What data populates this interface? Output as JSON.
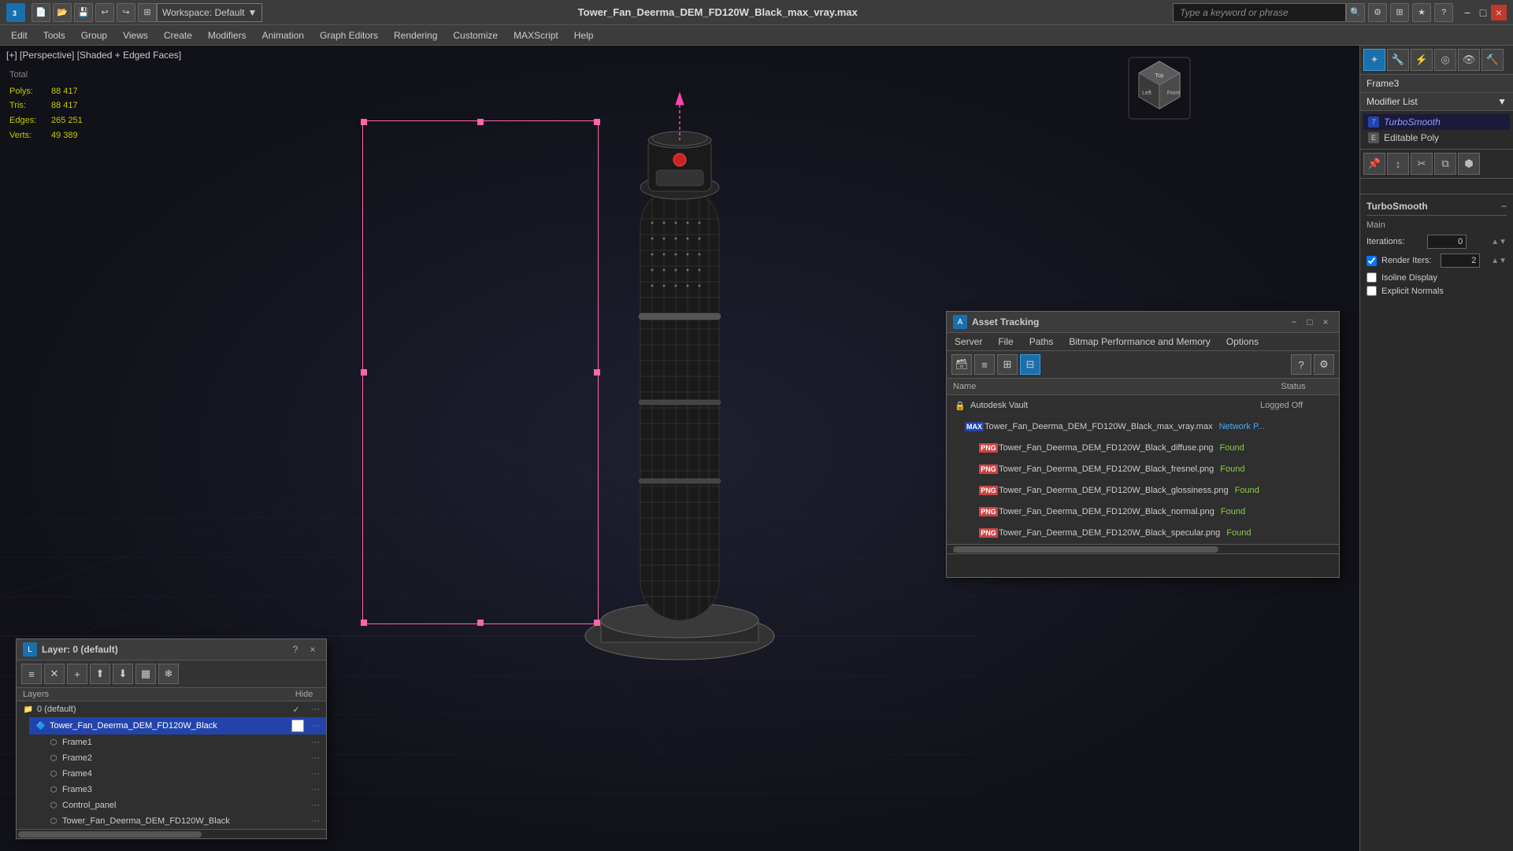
{
  "titlebar": {
    "app_name": "3ds Max",
    "file_name": "Tower_Fan_Deerma_DEM_FD120W_Black_max_vray.max",
    "workspace_label": "Workspace: Default",
    "search_placeholder": "Type a keyword or phrase",
    "win_minimize": "−",
    "win_restore": "□",
    "win_close": "×"
  },
  "menubar": {
    "items": [
      "Edit",
      "Tools",
      "Group",
      "Views",
      "Create",
      "Modifiers",
      "Animation",
      "Graph Editors",
      "Rendering",
      "Customize",
      "MAXScript",
      "Help"
    ]
  },
  "viewport": {
    "label": "[+] [Perspective] [Shaded + Edged Faces]",
    "stats": {
      "polys_label": "Polys:",
      "polys_value": "88 417",
      "tris_label": "Tris:",
      "tris_value": "88 417",
      "edges_label": "Edges:",
      "edges_value": "265 251",
      "verts_label": "Verts:",
      "verts_value": "49 389",
      "total_label": "Total"
    }
  },
  "right_sidebar": {
    "frame_label": "Frame3",
    "modifier_list_label": "Modifier List",
    "modifiers": [
      {
        "name": "TurboSmooth",
        "type": "italics"
      },
      {
        "name": "Editable Poly",
        "type": "normal"
      }
    ],
    "turbosm_title": "TurboSmooth",
    "turbosm_section": "Main",
    "iterations_label": "Iterations:",
    "iterations_value": "0",
    "render_iters_label": "Render Iters:",
    "render_iters_value": "2",
    "isoline_label": "Isoline Display",
    "explicit_normals_label": "Explicit Normals"
  },
  "layer_dialog": {
    "title": "Layer: 0 (default)",
    "question_icon": "?",
    "close_icon": "×",
    "headers": {
      "layers_label": "Layers",
      "hide_label": "Hide"
    },
    "layers": [
      {
        "name": "0 (default)",
        "indent": 0,
        "check": true,
        "type": "folder"
      },
      {
        "name": "Tower_Fan_Deerma_DEM_FD120W_Black",
        "indent": 1,
        "check": false,
        "type": "object",
        "selected": true
      },
      {
        "name": "Frame1",
        "indent": 2,
        "check": false,
        "type": "frame"
      },
      {
        "name": "Frame2",
        "indent": 2,
        "check": false,
        "type": "frame"
      },
      {
        "name": "Frame4",
        "indent": 2,
        "check": false,
        "type": "frame"
      },
      {
        "name": "Frame3",
        "indent": 2,
        "check": false,
        "type": "frame"
      },
      {
        "name": "Control_panel",
        "indent": 2,
        "check": false,
        "type": "frame"
      },
      {
        "name": "Tower_Fan_Deerma_DEM_FD120W_Black",
        "indent": 2,
        "check": false,
        "type": "object2"
      }
    ]
  },
  "asset_tracking": {
    "title": "Asset Tracking",
    "win_minimize": "−",
    "win_restore": "□",
    "win_close": "×",
    "menu": [
      "Server",
      "File",
      "Paths",
      "Bitmap Performance and Memory",
      "Options"
    ],
    "toolbar_buttons": [
      "db-icon",
      "list-icon",
      "grid2-icon",
      "table-icon"
    ],
    "table_headers": {
      "name": "Name",
      "status": "Status"
    },
    "rows": [
      {
        "name": "Autodesk Vault",
        "indent": 0,
        "icon": "vault",
        "status": "Logged Off"
      },
      {
        "name": "Tower_Fan_Deerma_DEM_FD120W_Black_max_vray.max",
        "indent": 1,
        "icon": "max",
        "status": "Network P..."
      },
      {
        "name": "Tower_Fan_Deerma_DEM_FD120W_Black_diffuse.png",
        "indent": 2,
        "icon": "png",
        "status": "Found"
      },
      {
        "name": "Tower_Fan_Deerma_DEM_FD120W_Black_fresnel.png",
        "indent": 2,
        "icon": "png",
        "status": "Found"
      },
      {
        "name": "Tower_Fan_Deerma_DEM_FD120W_Black_glossiness.png",
        "indent": 2,
        "icon": "png",
        "status": "Found"
      },
      {
        "name": "Tower_Fan_Deerma_DEM_FD120W_Black_normal.png",
        "indent": 2,
        "icon": "png",
        "status": "Found"
      },
      {
        "name": "Tower_Fan_Deerma_DEM_FD120W_Black_specular.png",
        "indent": 2,
        "icon": "png",
        "status": "Found"
      }
    ]
  }
}
